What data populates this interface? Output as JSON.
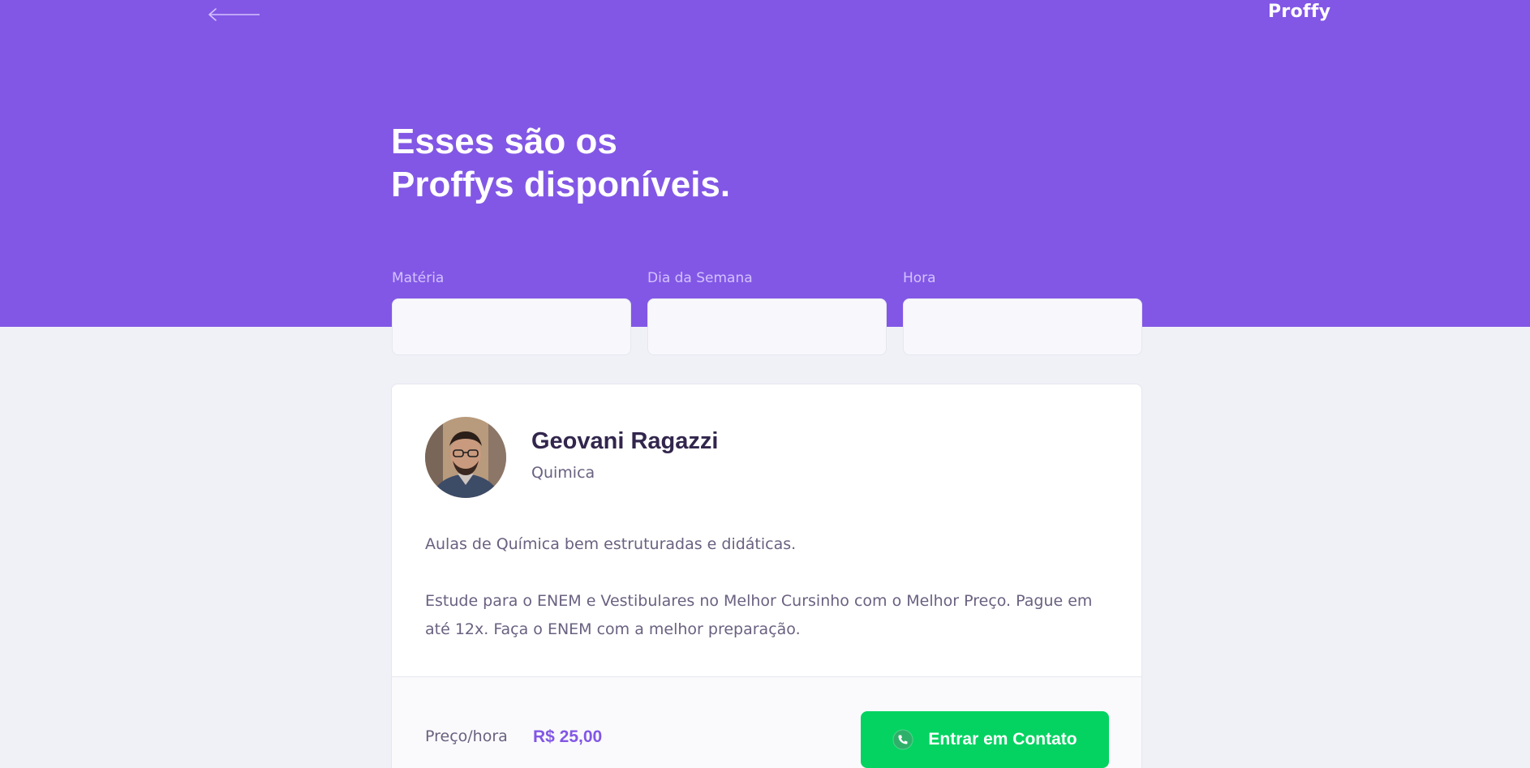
{
  "header": {
    "logo": "Proffy",
    "back_icon": "arrow-left-icon",
    "title_line1": "Esses são os",
    "title_line2": "Proffys disponíveis."
  },
  "filters": [
    {
      "label": "Matéria",
      "value": ""
    },
    {
      "label": "Dia da Semana",
      "value": ""
    },
    {
      "label": "Hora",
      "value": ""
    }
  ],
  "teacher": {
    "name": "Geovani Ragazzi",
    "subject": "Quimica",
    "bio": [
      "Aulas de Química bem estruturadas e didáticas.",
      "Estude para o ENEM e Vestibulares no Melhor Cursinho com o Melhor Preço. Pague em até 12x. Faça o ENEM com a melhor preparação."
    ],
    "price_label": "Preço/hora",
    "price_value": "R$ 25,00",
    "contact_label": "Entrar em Contato",
    "contact_icon": "whatsapp-icon"
  },
  "colors": {
    "primary": "#8257E5",
    "background": "#F0F0F7",
    "title_text": "#32264D",
    "body_text": "#6A6180",
    "contact_green": "#04D361"
  }
}
